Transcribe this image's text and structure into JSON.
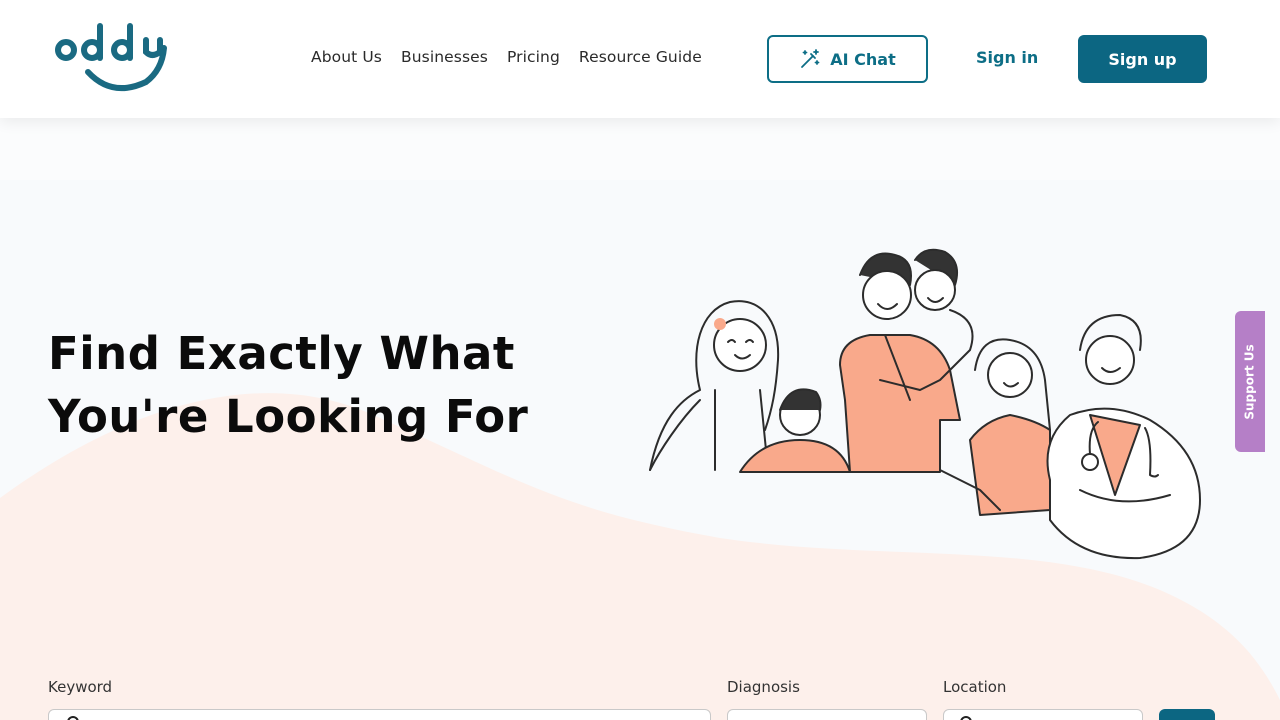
{
  "brand": {
    "logo_text": "oddy",
    "primary_color": "#0c6682",
    "accent_color": "#f9a98b",
    "support_color": "#b57fc7"
  },
  "nav": {
    "items": [
      {
        "label": "About Us"
      },
      {
        "label": "Businesses"
      },
      {
        "label": "Pricing"
      },
      {
        "label": "Resource Guide"
      }
    ],
    "ai_chat_label": "AI Chat",
    "ai_chat_icon": "magic-wand-icon",
    "signin_label": "Sign in",
    "signup_label": "Sign up"
  },
  "hero": {
    "title_line1": "Find Exactly What",
    "title_line2": "You're Looking For",
    "illustration": "group-of-people-illustration"
  },
  "support_tab": {
    "label": "Support Us"
  },
  "search": {
    "keyword_label": "Keyword",
    "diagnosis_label": "Diagnosis",
    "location_label": "Location",
    "search_icon": "search-icon",
    "location_icon": "map-pin-icon"
  }
}
